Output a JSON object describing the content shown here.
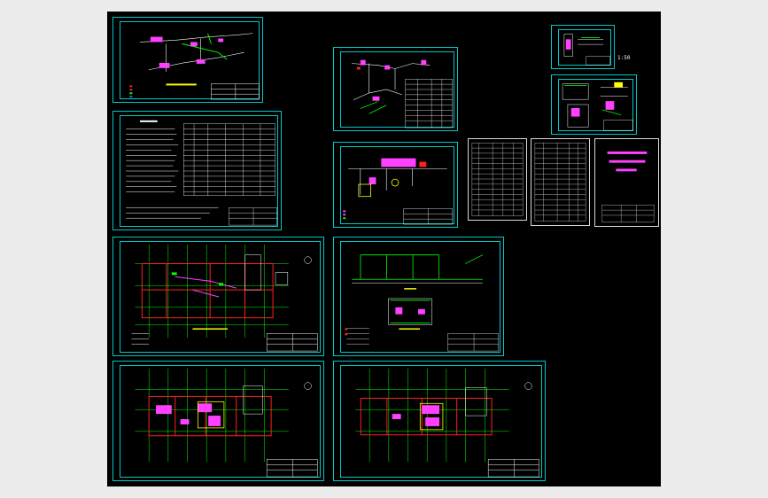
{
  "viewer": {
    "background": "#000000",
    "line_colors": {
      "frame": "#00c8c8",
      "wall": "#00ff00",
      "pipe": "#ff40ff",
      "red": "#ff2020",
      "yellow": "#ffff00",
      "white": "#ffffff"
    }
  },
  "sheets": [
    {
      "id": "system-diagram"
    },
    {
      "id": "design-notes"
    },
    {
      "id": "floor-plan-1"
    },
    {
      "id": "floor-plan-2"
    },
    {
      "id": "floor-plan-3"
    },
    {
      "id": "axonometric-small"
    },
    {
      "id": "equipment-detail"
    },
    {
      "id": "section-elevation"
    },
    {
      "id": "material-list-1"
    },
    {
      "id": "material-list-2"
    },
    {
      "id": "cover-sheet"
    },
    {
      "id": "detail-small-1"
    },
    {
      "id": "detail-small-2"
    }
  ],
  "labels": {
    "scale_note": "1:50"
  }
}
